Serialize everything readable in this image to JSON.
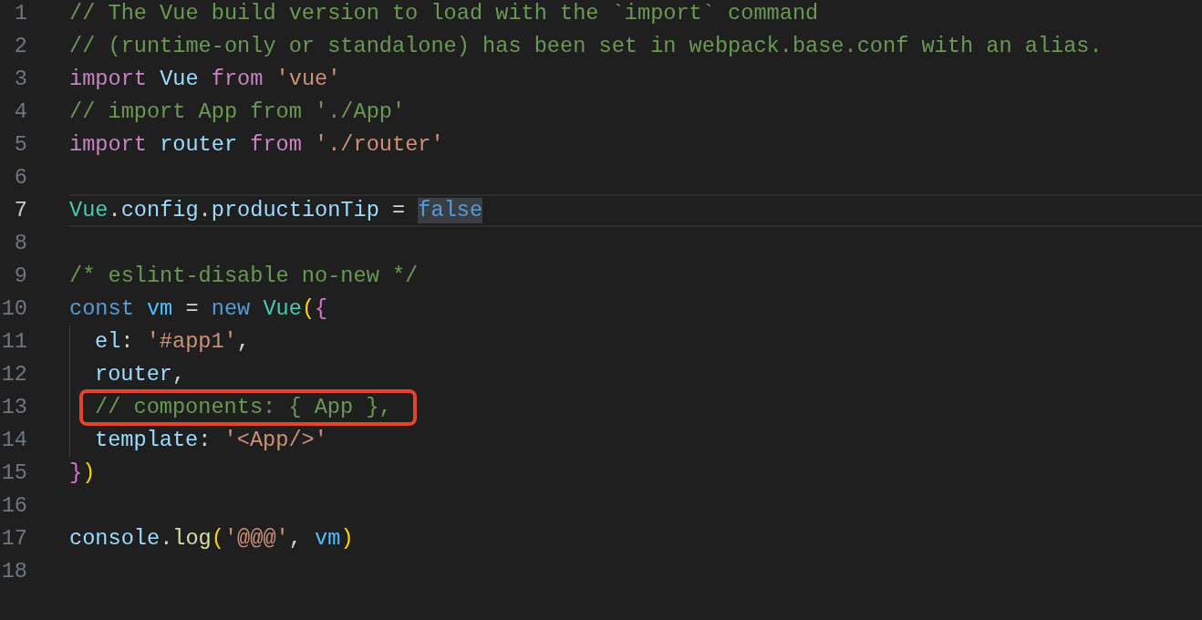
{
  "editor": {
    "lines": [
      {
        "number": "1",
        "current": false,
        "indented": false,
        "boxed": false,
        "tokens": [
          {
            "text": "// The Vue build version to load with the `import` command",
            "kind": "comment"
          }
        ]
      },
      {
        "number": "2",
        "current": false,
        "indented": false,
        "boxed": false,
        "tokens": [
          {
            "text": "// (runtime-only or standalone) has been set in webpack.base.conf with an alias.",
            "kind": "comment"
          }
        ]
      },
      {
        "number": "3",
        "current": false,
        "indented": false,
        "boxed": false,
        "tokens": [
          {
            "text": "import ",
            "kind": "control"
          },
          {
            "text": "Vue ",
            "kind": "variable"
          },
          {
            "text": "from ",
            "kind": "control"
          },
          {
            "text": "'vue'",
            "kind": "string"
          }
        ]
      },
      {
        "number": "4",
        "current": false,
        "indented": false,
        "boxed": false,
        "tokens": [
          {
            "text": "// import App from './App'",
            "kind": "comment"
          }
        ]
      },
      {
        "number": "5",
        "current": false,
        "indented": false,
        "boxed": false,
        "tokens": [
          {
            "text": "import ",
            "kind": "control"
          },
          {
            "text": "router ",
            "kind": "variable"
          },
          {
            "text": "from ",
            "kind": "control"
          },
          {
            "text": "'./router'",
            "kind": "string"
          }
        ]
      },
      {
        "number": "6",
        "current": false,
        "indented": false,
        "boxed": false
      },
      {
        "number": "7",
        "current": true,
        "indented": false,
        "boxed": false,
        "tokens": [
          {
            "text": "Vue",
            "kind": "class",
            "selected": false
          },
          {
            "text": ".",
            "kind": "plain",
            "selected": false
          },
          {
            "text": "config",
            "kind": "variable",
            "selected": false
          },
          {
            "text": ".",
            "kind": "plain",
            "selected": false
          },
          {
            "text": "productionTip",
            "kind": "variable",
            "selected": false
          },
          {
            "text": " = ",
            "kind": "plain",
            "selected": false
          },
          {
            "text": "false",
            "kind": "storage",
            "selected": true
          }
        ]
      },
      {
        "number": "8",
        "current": false,
        "indented": false,
        "boxed": false
      },
      {
        "number": "9",
        "current": false,
        "indented": false,
        "boxed": false,
        "tokens": [
          {
            "text": "/* eslint-disable no-new */",
            "kind": "comment"
          }
        ]
      },
      {
        "number": "10",
        "current": false,
        "indented": false,
        "boxed": false,
        "tokens": [
          {
            "text": "const ",
            "kind": "storage"
          },
          {
            "text": "vm",
            "kind": "constant"
          },
          {
            "text": " = ",
            "kind": "plain"
          },
          {
            "text": "new ",
            "kind": "storage"
          },
          {
            "text": "Vue",
            "kind": "class"
          },
          {
            "text": "(",
            "kind": "bracket1"
          },
          {
            "text": "{",
            "kind": "bracket2"
          }
        ]
      },
      {
        "number": "11",
        "current": false,
        "indented": true,
        "boxed": false,
        "tokens": [
          {
            "text": "el",
            "kind": "variable"
          },
          {
            "text": ": ",
            "kind": "plain"
          },
          {
            "text": "'#app1'",
            "kind": "string"
          },
          {
            "text": ",",
            "kind": "plain"
          }
        ]
      },
      {
        "number": "12",
        "current": false,
        "indented": true,
        "boxed": false,
        "tokens": [
          {
            "text": "router",
            "kind": "variable"
          },
          {
            "text": ",",
            "kind": "plain"
          }
        ]
      },
      {
        "number": "13",
        "current": false,
        "indented": true,
        "boxed": true,
        "tokens": [
          {
            "text": "// components: { App },",
            "kind": "comment"
          }
        ]
      },
      {
        "number": "14",
        "current": false,
        "indented": true,
        "boxed": false,
        "tokens": [
          {
            "text": "template",
            "kind": "variable"
          },
          {
            "text": ": ",
            "kind": "plain"
          },
          {
            "text": "'<App/>'",
            "kind": "string"
          }
        ]
      },
      {
        "number": "15",
        "current": false,
        "indented": false,
        "boxed": false,
        "tokens": [
          {
            "text": "}",
            "kind": "bracket2"
          },
          {
            "text": ")",
            "kind": "bracket1"
          }
        ]
      },
      {
        "number": "16",
        "current": false,
        "indented": false,
        "boxed": false
      },
      {
        "number": "17",
        "current": false,
        "indented": false,
        "boxed": false,
        "tokens": [
          {
            "text": "console",
            "kind": "variable"
          },
          {
            "text": ".",
            "kind": "plain"
          },
          {
            "text": "log",
            "kind": "function"
          },
          {
            "text": "(",
            "kind": "bracket1"
          },
          {
            "text": "'@@@'",
            "kind": "string"
          },
          {
            "text": ", ",
            "kind": "plain"
          },
          {
            "text": "vm",
            "kind": "constant"
          },
          {
            "text": ")",
            "kind": "bracket1"
          }
        ]
      },
      {
        "number": "18",
        "current": false,
        "indented": false,
        "boxed": false
      }
    ]
  }
}
